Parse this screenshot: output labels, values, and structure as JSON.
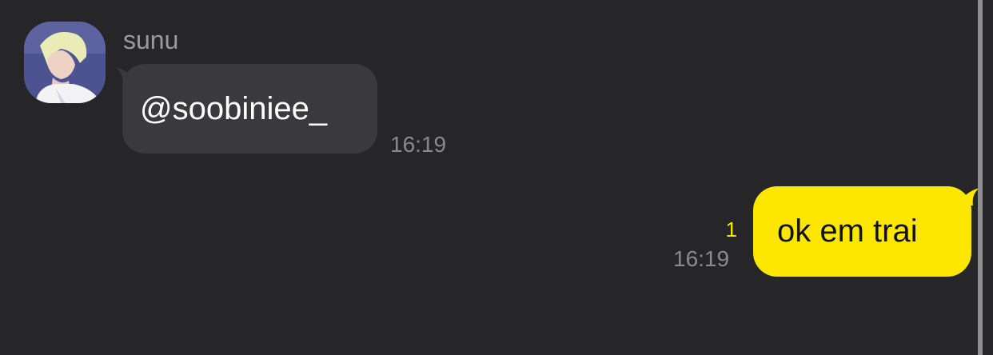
{
  "messages": [
    {
      "direction": "incoming",
      "sender": "sunu",
      "text": "@soobiniee_",
      "time": "16:19"
    },
    {
      "direction": "outgoing",
      "text": "ok em trai",
      "time": "16:19",
      "unread_count": "1"
    }
  ],
  "colors": {
    "background": "#262628",
    "incoming_bubble": "#3a3a3c",
    "outgoing_bubble": "#fde700",
    "unread_badge": "#fde700",
    "timestamp": "#8a8a8c"
  }
}
